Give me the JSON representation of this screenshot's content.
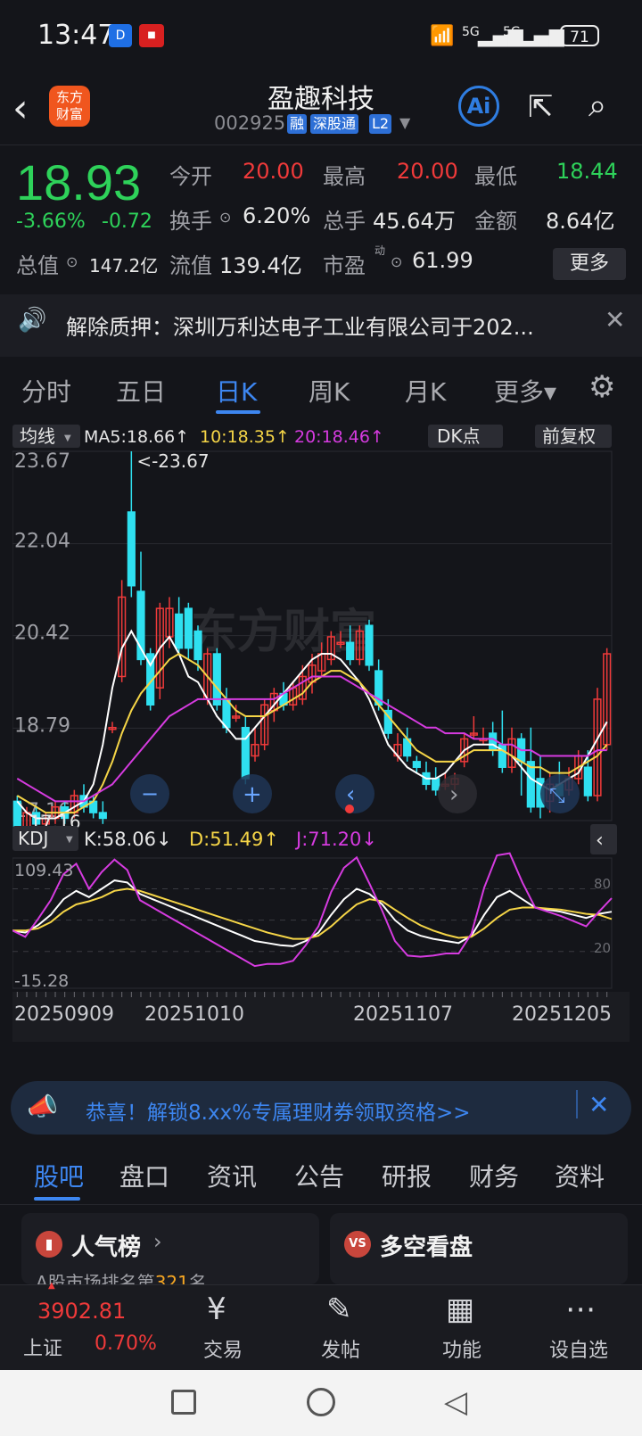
{
  "status": {
    "time": "13:47",
    "net1": "5G",
    "net2": "5G",
    "battery": "71"
  },
  "header": {
    "logo": "东方\n财富",
    "name": "盈趣科技",
    "code": "002925",
    "tags": [
      "融",
      "深股通",
      "L2"
    ]
  },
  "quote": {
    "price": "18.93",
    "change_pct": "-3.66%",
    "change": "-0.72",
    "open_label": "今开",
    "open": "20.00",
    "high_label": "最高",
    "high": "20.00",
    "low_label": "最低",
    "low": "18.44",
    "turnover_label": "换手",
    "turnover": "6.20%",
    "volume_label": "总手",
    "volume": "45.64万",
    "amount_label": "金额",
    "amount": "8.64亿",
    "mcap_label": "总值",
    "mcap": "147.2亿",
    "float_label": "流值",
    "float": "139.4亿",
    "pe_label": "市盈",
    "pe_sup": "动",
    "pe": "61.99",
    "more": "更多"
  },
  "news": {
    "text": "解除质押：深圳万利达电子工业有限公司于202..."
  },
  "tabs": {
    "items": [
      "分时",
      "五日",
      "日K",
      "周K",
      "月K",
      "更多▾"
    ],
    "active": 2
  },
  "chart_controls": {
    "ma_btn": "均线",
    "ma5": "MA5:18.66↑",
    "ma10": "10:18.35↑",
    "ma20": "20:18.46↑",
    "dk": "DK点",
    "fq": "前复权",
    "kdj_btn": "KDJ",
    "k": "K:58.06↓",
    "d": "D:51.49↑",
    "j": "J:71.20↓",
    "watermark": "东方财富"
  },
  "chart_data": {
    "type": "candlestick",
    "price_axis": {
      "ticks": [
        "23.67",
        "22.04",
        "20.42",
        "18.79",
        "17.16"
      ],
      "ylim": [
        17.16,
        23.67
      ]
    },
    "max_annot": "<-23.67",
    "min_annot": "17.16",
    "kdj_axis": {
      "top": "109.43",
      "bottom": "-15.28",
      "levels": [
        "80",
        "20"
      ]
    },
    "x_labels": [
      "20250909",
      "20251010",
      "20251107",
      "20251205"
    ],
    "candles": [
      [
        17.5,
        17.0,
        17.6,
        16.9
      ],
      [
        17.0,
        17.3,
        17.4,
        16.9
      ],
      [
        17.3,
        17.1,
        17.4,
        17.0
      ],
      [
        17.1,
        17.2,
        17.3,
        17.0
      ],
      [
        17.2,
        17.4,
        17.5,
        17.1
      ],
      [
        17.4,
        17.2,
        17.5,
        17.1
      ],
      [
        17.3,
        17.6,
        17.7,
        17.2
      ],
      [
        17.6,
        17.4,
        17.8,
        17.3
      ],
      [
        17.5,
        17.3,
        17.6,
        17.2
      ],
      [
        17.3,
        17.2,
        17.5,
        17.1
      ],
      [
        18.8,
        18.8,
        18.9,
        18.7
      ],
      [
        19.7,
        21.1,
        21.4,
        19.6
      ],
      [
        22.6,
        21.3,
        23.67,
        21.1
      ],
      [
        21.2,
        20.0,
        21.9,
        19.9
      ],
      [
        20.1,
        19.2,
        20.2,
        19.1
      ],
      [
        19.5,
        20.9,
        21.0,
        19.3
      ],
      [
        20.4,
        20.9,
        21.1,
        20.2
      ],
      [
        20.8,
        20.2,
        21.1,
        20.1
      ],
      [
        20.9,
        20.2,
        21.0,
        20.0
      ],
      [
        20.5,
        20.0,
        20.6,
        19.8
      ],
      [
        19.3,
        20.1,
        20.2,
        19.2
      ],
      [
        20.1,
        19.2,
        20.2,
        19.1
      ],
      [
        19.3,
        18.8,
        19.5,
        18.7
      ],
      [
        19.0,
        19.0,
        19.2,
        18.9
      ],
      [
        18.8,
        17.9,
        19.0,
        17.8
      ],
      [
        18.3,
        18.5,
        18.8,
        18.2
      ],
      [
        18.5,
        19.2,
        19.3,
        18.4
      ],
      [
        19.1,
        19.4,
        19.5,
        18.9
      ],
      [
        19.4,
        19.2,
        19.6,
        19.1
      ],
      [
        19.2,
        19.5,
        19.6,
        19.1
      ],
      [
        19.3,
        19.7,
        19.9,
        19.2
      ],
      [
        19.6,
        19.9,
        20.1,
        19.4
      ],
      [
        19.8,
        20.1,
        20.3,
        19.7
      ],
      [
        20.0,
        20.4,
        20.5,
        19.9
      ],
      [
        20.3,
        20.3,
        20.5,
        20.2
      ],
      [
        20.3,
        20.0,
        20.6,
        19.9
      ],
      [
        20.0,
        20.5,
        20.6,
        19.9
      ],
      [
        20.6,
        19.9,
        20.7,
        19.8
      ],
      [
        19.8,
        19.2,
        20.0,
        19.1
      ],
      [
        19.1,
        18.7,
        19.3,
        18.6
      ],
      [
        18.3,
        18.5,
        18.7,
        18.2
      ],
      [
        18.6,
        18.3,
        18.8,
        18.2
      ],
      [
        18.2,
        18.1,
        18.3,
        18.0
      ],
      [
        18.0,
        17.8,
        18.2,
        17.7
      ],
      [
        17.9,
        17.7,
        18.1,
        17.6
      ],
      [
        17.8,
        17.8,
        18.0,
        17.7
      ],
      [
        17.8,
        17.9,
        18.0,
        17.7
      ],
      [
        18.2,
        18.6,
        18.7,
        18.1
      ],
      [
        18.7,
        18.7,
        19.0,
        18.6
      ],
      [
        18.6,
        18.6,
        18.8,
        18.5
      ],
      [
        18.7,
        18.4,
        18.9,
        18.3
      ],
      [
        18.5,
        18.1,
        19.1,
        18.0
      ],
      [
        18.1,
        18.6,
        18.8,
        18.0
      ],
      [
        18.6,
        18.2,
        18.7,
        17.6
      ],
      [
        18.2,
        17.4,
        18.8,
        17.3
      ],
      [
        17.9,
        17.4,
        18.3,
        17.2
      ],
      [
        17.5,
        17.8,
        18.0,
        17.3
      ],
      [
        17.8,
        17.6,
        18.2,
        17.5
      ],
      [
        17.7,
        17.9,
        18.1,
        17.6
      ],
      [
        17.9,
        18.3,
        18.4,
        17.8
      ],
      [
        18.1,
        17.6,
        18.4,
        17.5
      ],
      [
        17.6,
        19.3,
        19.5,
        17.5
      ],
      [
        18.5,
        20.1,
        20.2,
        18.4
      ]
    ],
    "ma5": [
      17.5,
      17.3,
      17.2,
      17.2,
      17.2,
      17.3,
      17.4,
      17.5,
      17.8,
      18.5,
      19.5,
      20.2,
      20.5,
      20.2,
      19.9,
      20.2,
      20.4,
      20.1,
      19.7,
      19.6,
      19.3,
      19.0,
      18.8,
      18.6,
      18.6,
      18.8,
      19.0,
      19.2,
      19.4,
      19.6,
      19.8,
      20.0,
      20.1,
      20.1,
      20.0,
      19.8,
      19.6,
      19.3,
      18.9,
      18.5,
      18.3,
      18.1,
      18.0,
      17.9,
      17.9,
      18.0,
      18.2,
      18.4,
      18.5,
      18.5,
      18.5,
      18.4,
      18.3,
      18.1,
      17.9,
      17.8,
      17.7,
      17.8,
      17.9,
      18.0,
      18.3,
      18.6,
      18.9
    ],
    "ma10": [
      17.6,
      17.5,
      17.4,
      17.3,
      17.3,
      17.3,
      17.3,
      17.4,
      17.5,
      17.8,
      18.2,
      18.7,
      19.1,
      19.4,
      19.6,
      19.8,
      20.0,
      20.1,
      20.0,
      19.9,
      19.7,
      19.5,
      19.3,
      19.1,
      19.0,
      19.0,
      19.0,
      19.1,
      19.2,
      19.3,
      19.4,
      19.6,
      19.7,
      19.8,
      19.8,
      19.7,
      19.6,
      19.4,
      19.2,
      19.0,
      18.8,
      18.6,
      18.4,
      18.3,
      18.2,
      18.2,
      18.2,
      18.3,
      18.4,
      18.4,
      18.4,
      18.4,
      18.3,
      18.2,
      18.1,
      18.1,
      18.0,
      18.0,
      18.0,
      18.1,
      18.2,
      18.3,
      18.5
    ],
    "ma20": [
      17.9,
      17.8,
      17.7,
      17.6,
      17.5,
      17.5,
      17.5,
      17.5,
      17.6,
      17.7,
      17.8,
      18.0,
      18.2,
      18.4,
      18.6,
      18.8,
      19.0,
      19.1,
      19.2,
      19.3,
      19.3,
      19.3,
      19.3,
      19.3,
      19.3,
      19.3,
      19.3,
      19.3,
      19.4,
      19.5,
      19.6,
      19.7,
      19.7,
      19.7,
      19.7,
      19.6,
      19.5,
      19.4,
      19.3,
      19.2,
      19.1,
      19.0,
      18.9,
      18.8,
      18.8,
      18.7,
      18.7,
      18.7,
      18.6,
      18.6,
      18.6,
      18.5,
      18.5,
      18.4,
      18.4,
      18.3,
      18.3,
      18.3,
      18.3,
      18.3,
      18.3,
      18.4,
      18.4
    ],
    "kdj_k": [
      40,
      38,
      45,
      55,
      70,
      78,
      72,
      80,
      88,
      86,
      75,
      70,
      65,
      60,
      55,
      50,
      45,
      40,
      35,
      30,
      28,
      26,
      25,
      30,
      38,
      55,
      70,
      80,
      75,
      65,
      50,
      40,
      35,
      32,
      30,
      28,
      35,
      55,
      72,
      78,
      70,
      62,
      60,
      58,
      55,
      52,
      56,
      58
    ],
    "kdj_d": [
      40,
      40,
      42,
      48,
      58,
      65,
      68,
      72,
      78,
      80,
      78,
      74,
      70,
      66,
      62,
      58,
      54,
      50,
      46,
      42,
      38,
      35,
      32,
      32,
      35,
      44,
      55,
      65,
      70,
      68,
      60,
      52,
      45,
      40,
      36,
      33,
      34,
      42,
      52,
      60,
      62,
      62,
      61,
      60,
      58,
      56,
      55,
      51
    ],
    "kdj_j": [
      40,
      34,
      51,
      69,
      94,
      104,
      80,
      96,
      108,
      98,
      69,
      62,
      55,
      48,
      41,
      34,
      27,
      20,
      13,
      6,
      8,
      8,
      11,
      26,
      44,
      77,
      100,
      110,
      85,
      59,
      30,
      16,
      15,
      16,
      18,
      18,
      37,
      81,
      112,
      114,
      86,
      62,
      58,
      54,
      49,
      44,
      58,
      71
    ]
  },
  "banner": {
    "text": "恭喜！解锁8.xx%专属理财券领取资格>>"
  },
  "section_tabs": {
    "items": [
      "股吧",
      "盘口",
      "资讯",
      "公告",
      "研报",
      "财务",
      "资料"
    ],
    "active": 0
  },
  "cards": {
    "left_title": "人气榜",
    "left_sub": "A股市场排名第",
    "left_rank": "321",
    "left_suffix": "名",
    "right_title": "多空看盘"
  },
  "bottom_nav": {
    "index_value": "3902.81",
    "index_name": "上证",
    "index_change": "0.70%",
    "items": [
      "交易",
      "发帖",
      "功能",
      "设自选"
    ]
  }
}
